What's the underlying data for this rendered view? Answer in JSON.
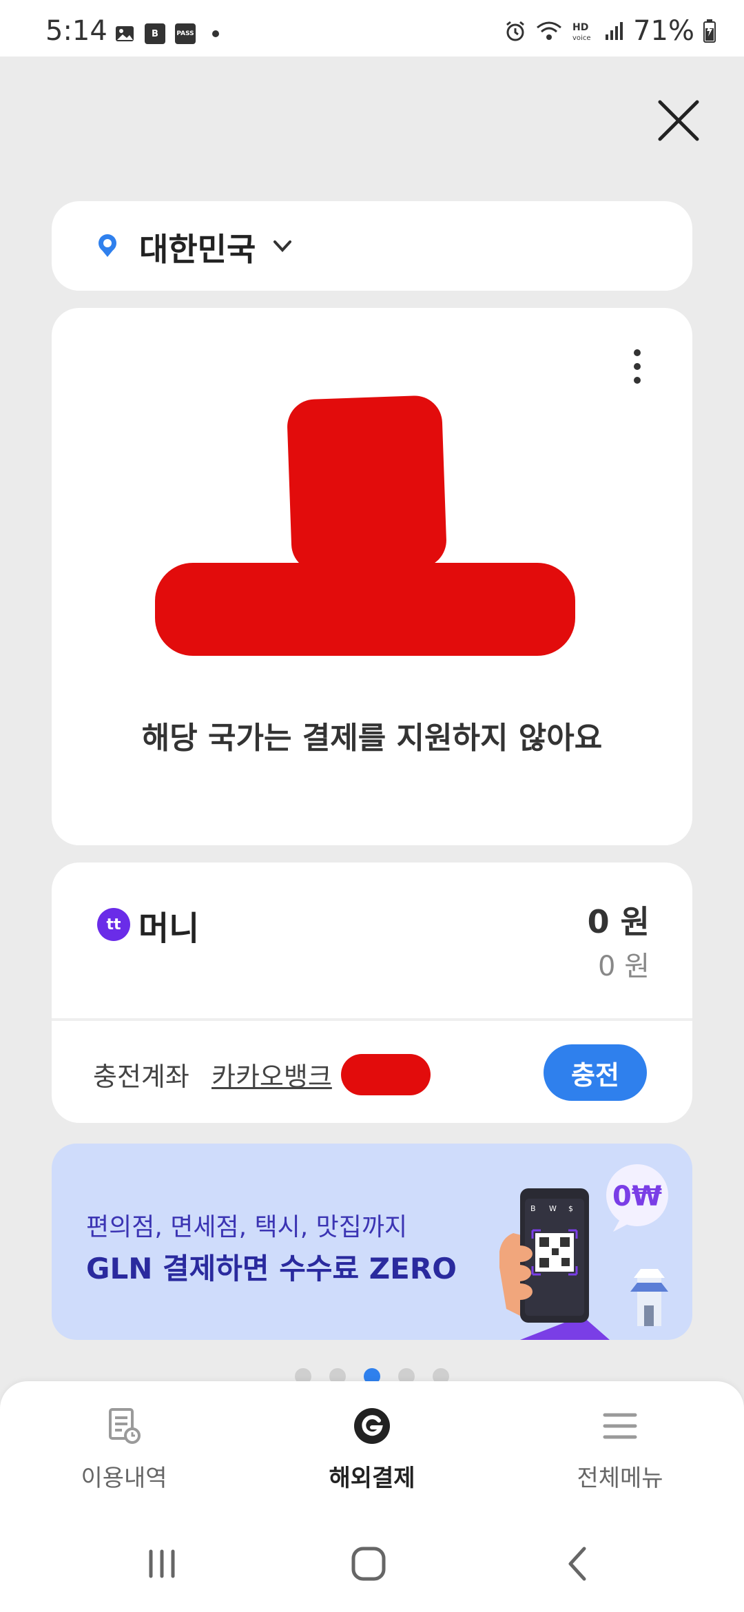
{
  "status_bar": {
    "time": "5:14",
    "battery_percent": "71%",
    "pass_label": "PASS"
  },
  "country_selector": {
    "label": "대한민국"
  },
  "payment_card": {
    "notice": "해당 국가는 결제를 지원하지 않아요"
  },
  "money": {
    "logo_text": "tt",
    "label": "머니",
    "balance": "0 원",
    "sub_balance": "0 원",
    "account_label": "충전계좌",
    "account_bank": "카카오뱅크",
    "charge_button": "충전"
  },
  "banner": {
    "line1": "편의점, 면세점, 택시, 맛집까지",
    "line2": "GLN 결제하면 수수료 ZERO",
    "badge": "0₩"
  },
  "pagination": {
    "total": 5,
    "active_index": 2
  },
  "bottom_nav": {
    "items": [
      {
        "label": "이용내역"
      },
      {
        "label": "해외결제"
      },
      {
        "label": "전체메뉴"
      }
    ]
  },
  "colors": {
    "accent": "#2f80ed",
    "money_brand": "#6a2ce8",
    "redaction": "#e20c0c",
    "banner_bg": "#cfdcfb"
  }
}
